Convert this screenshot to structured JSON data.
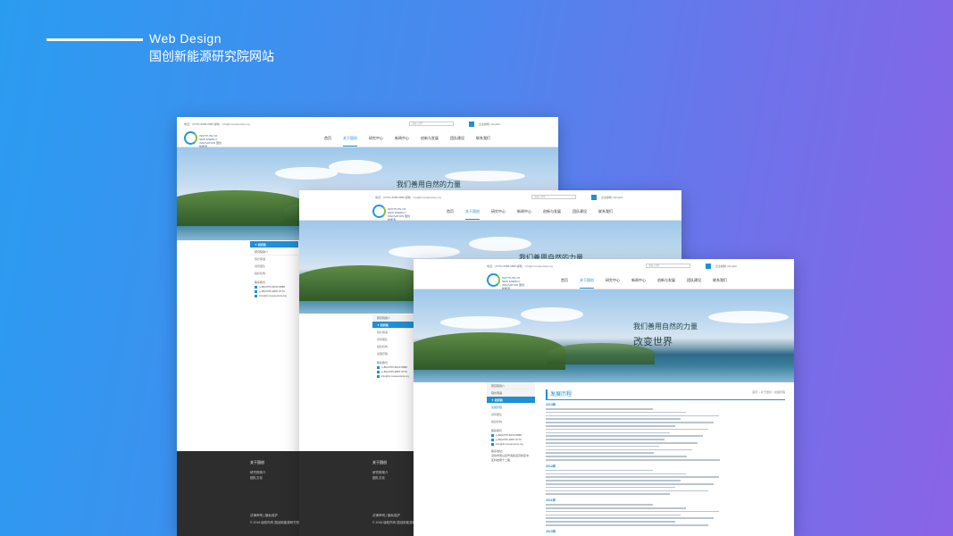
{
  "header": {
    "subtitle_en": "Web Design",
    "title_cn": "国创新能源研究院网站"
  },
  "site": {
    "contact_line": "电话：(0755) 8888-8888   邮箱：info@innovasociety.org",
    "search_placeholder": "请输入搜索",
    "top_links": "企业邮箱  |  English",
    "logo_text": "INSTITUTE OF NEW ENERGY INNOVATION 国创新能源",
    "nav": [
      "首页",
      "关于国创",
      "研究中心",
      "新闻中心",
      "创新与发展",
      "团队建设",
      "联系我们"
    ],
    "nav_active": "关于国创",
    "slogan_line1": "我们善用自然的力量",
    "slogan_line2": "改变世界"
  },
  "sidebar": {
    "head": "▼ 研究院",
    "items": [
      "研究院简介",
      "院长寄语",
      "领导团队",
      "组织机构",
      "发展历程"
    ],
    "contact_title": "联系我们",
    "contact": [
      "(+86)0755-8233 8888",
      "(+86)0755-2887 8770",
      "info@innovasociety.org"
    ],
    "address_title": "联系地址：",
    "address": "深圳市南山区粤海街道高新区中区科技南十二路"
  },
  "content": {
    "title": "发展历程",
    "crumb": "首页 > 关于国创 > 发展历程",
    "years": [
      "2013年",
      "2012年",
      "2011年",
      "2010年"
    ]
  },
  "footer": {
    "title": "关于国创",
    "links": [
      "研究院简介",
      "团队文化"
    ],
    "bottom": "法律声明  |  隐私保护",
    "copyright": "© 2016 版权所有  国创新能源研究院"
  }
}
